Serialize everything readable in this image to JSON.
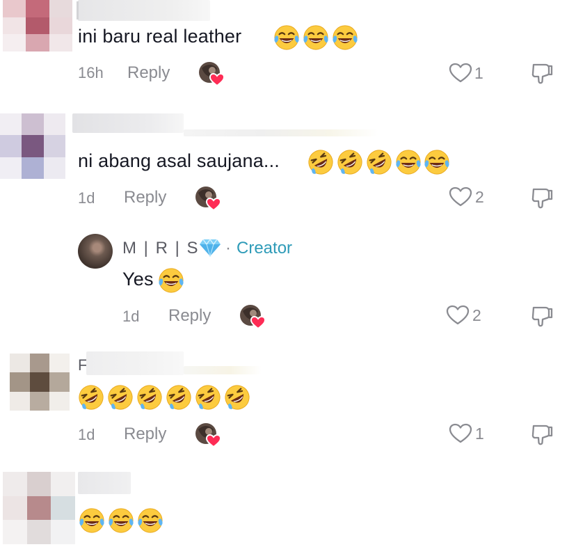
{
  "comments": [
    {
      "text": "ini baru real leather",
      "emojis": [
        "joy",
        "joy",
        "joy"
      ],
      "time": "16h",
      "reply_label": "Reply",
      "likes": "1"
    },
    {
      "text": "ni abang asal saujana...",
      "emojis": [
        "rofl",
        "rofl",
        "rofl",
        "joy",
        "joy"
      ],
      "time": "1d",
      "reply_label": "Reply",
      "likes": "2"
    },
    {
      "author": "M | R | S",
      "creator_separator": "·",
      "creator_label": "Creator",
      "text": "Yes",
      "emojis": [
        "joy"
      ],
      "time": "1d",
      "reply_label": "Reply",
      "likes": "2"
    },
    {
      "author_initial": "F",
      "text": "",
      "emojis": [
        "rofl",
        "rofl",
        "rofl",
        "rofl",
        "rofl",
        "rofl"
      ],
      "time": "1d",
      "reply_label": "Reply",
      "likes": "1"
    },
    {
      "text": "",
      "emojis": [
        "joy",
        "joy",
        "joy"
      ]
    }
  ],
  "icons": {
    "like": "heart-outline-icon",
    "dislike": "thumbs-down-outline-icon",
    "creator_liked": "creator-avatar-heart-icon",
    "verified": "diamond-icon"
  },
  "colors": {
    "creator_label": "#2e9bb8",
    "heart_badge": "#fe2c55",
    "muted_text": "#8a8b91"
  }
}
